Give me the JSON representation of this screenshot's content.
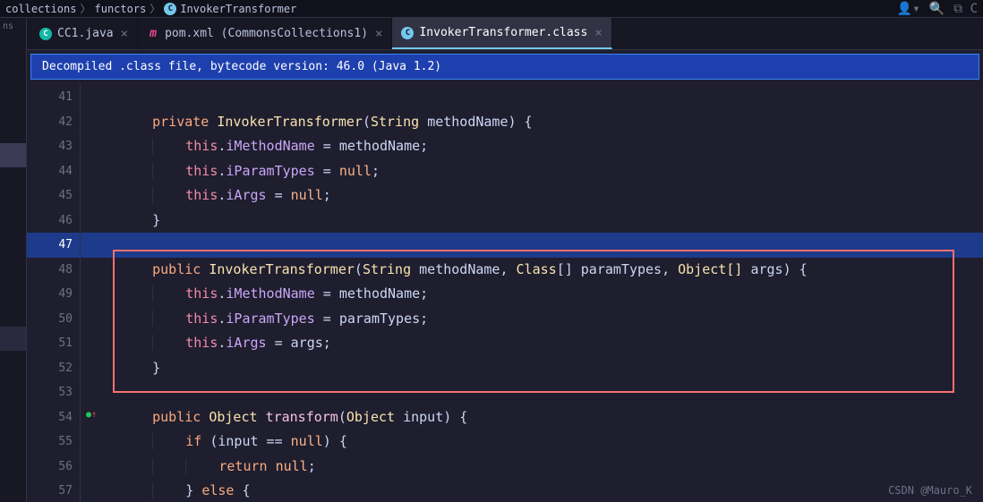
{
  "breadcrumb": {
    "p1": "collections",
    "p2": "functors",
    "p3": "InvokerTransformer"
  },
  "tabs": {
    "t1": "CC1.java",
    "t2": "pom.xml (CommonsCollections1)",
    "t3": "InvokerTransformer.class"
  },
  "banner": "Decompiled .class file, bytecode version: 46.0 (Java 1.2)",
  "gutter_label": "ns",
  "lines": {
    "n41": "41",
    "n42": "42",
    "n43": "43",
    "n44": "44",
    "n45": "45",
    "n46": "46",
    "n47": "47",
    "n48": "48",
    "n49": "49",
    "n50": "50",
    "n51": "51",
    "n52": "52",
    "n53": "53",
    "n54": "54",
    "n55": "55",
    "n56": "56",
    "n57": "57"
  },
  "tok": {
    "private": "private",
    "public": "public",
    "class": "InvokerTransformer",
    "String": "String",
    "Class": "Class",
    "ObjectArr": "Object[]",
    "Object": "Object",
    "param_methodName": "methodName",
    "param_paramTypes": "paramTypes",
    "param_args": "args",
    "param_input": "input",
    "this": "this",
    "iMethodName": "iMethodName",
    "iParamTypes": "iParamTypes",
    "iArgs": "iArgs",
    "null": "null",
    "transform": "transform",
    "if": "if",
    "return": "return",
    "else": "else",
    "eq": " = ",
    "eqeq": " == "
  },
  "watermark": "CSDN @Mauro_K"
}
